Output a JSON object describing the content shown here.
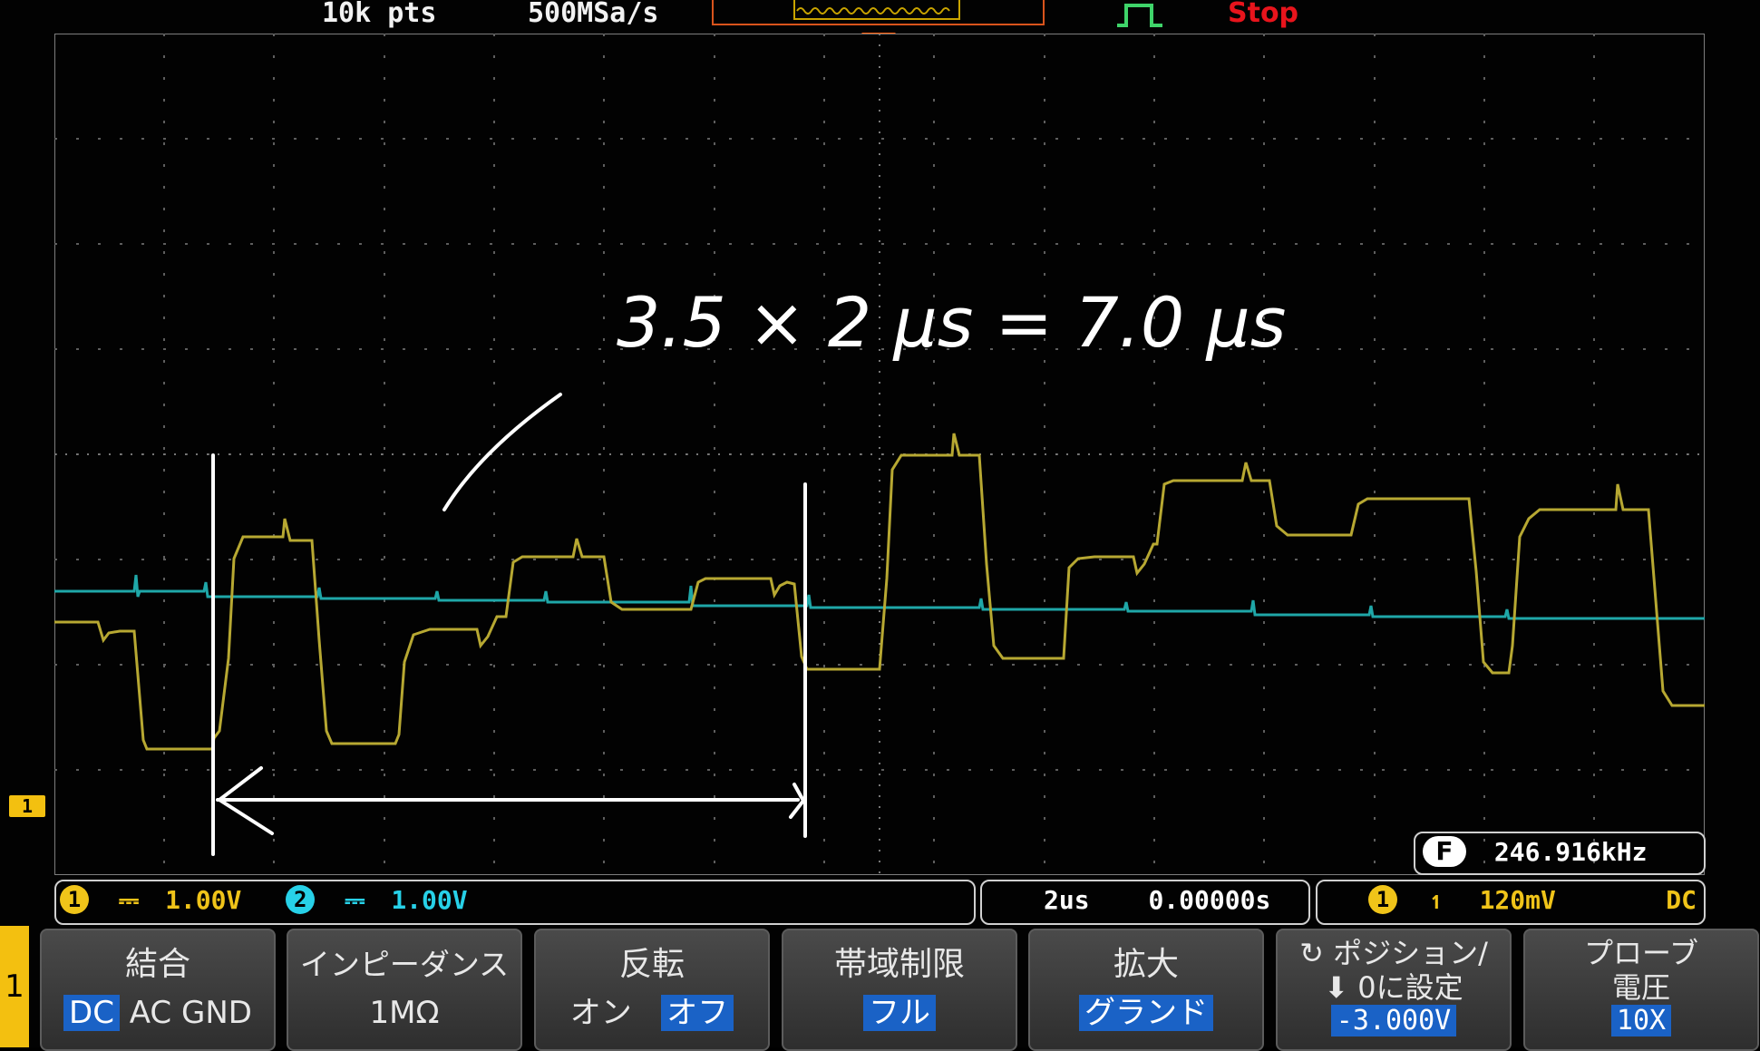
{
  "header": {
    "points": "10k pts",
    "sample_rate": "500MSa/s",
    "status": "Stop"
  },
  "channel_marker": "1",
  "annotation": "3.5 × 2 μs = 7.0 μs",
  "status_bar": {
    "ch1_number": "1",
    "ch1_scale": "1.00V",
    "ch2_number": "2",
    "ch2_scale": "1.00V",
    "time_div": "2us",
    "time_offset": "0.00000s",
    "trig_source": "1",
    "trig_level": "120mV",
    "trig_coupling": "DC"
  },
  "frequency": {
    "badge": "F",
    "value": "246.916kHz"
  },
  "side_tab": "1",
  "menu": {
    "coupling": {
      "title": "結合",
      "dc": "DC",
      "ac": "AC",
      "gnd": "GND"
    },
    "impedance": {
      "title": "インピーダンス",
      "value": "1MΩ"
    },
    "invert": {
      "title": "反転",
      "on": "オン",
      "off": "オフ"
    },
    "bandwidth": {
      "title": "帯域制限",
      "value": "フル"
    },
    "expand": {
      "title": "拡大",
      "value": "グランド"
    },
    "position": {
      "title": "ポジション/",
      "title2": "0に設定",
      "value": "-3.000V"
    },
    "probe": {
      "title": "プローブ",
      "title2": "電圧",
      "value": "10X"
    }
  },
  "colors": {
    "ch1": "#f0c419",
    "ch2": "#27d1e8",
    "trace1": "#b7a832",
    "trace2": "#1fa7a8",
    "stop": "#e8141c"
  }
}
